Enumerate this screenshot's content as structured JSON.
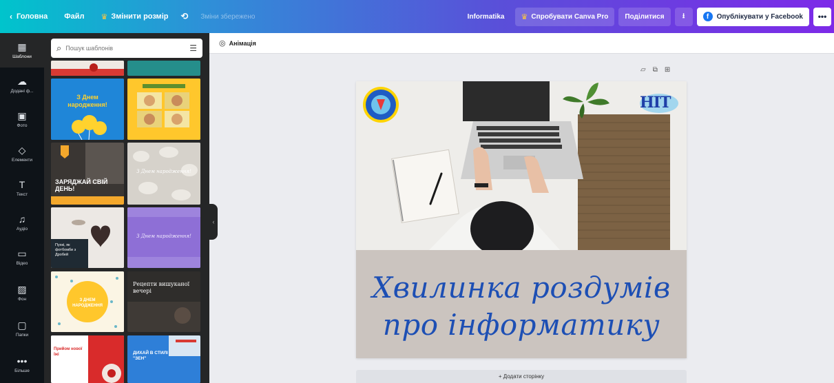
{
  "topbar": {
    "home": "Головна",
    "file": "Файл",
    "resize": "Змінити розмір",
    "saved_status": "Зміни збережено",
    "design_name": "Informatika",
    "try_pro": "Спробувати Canva Pro",
    "share": "Поділитися",
    "publish_facebook": "Опублікувати у Facebook",
    "more": "•••"
  },
  "rail": {
    "items": [
      {
        "label": "Шаблони",
        "icon": "layout-icon"
      },
      {
        "label": "Додані ф...",
        "icon": "cloud-upload-icon"
      },
      {
        "label": "Фото",
        "icon": "photo-icon"
      },
      {
        "label": "Елементи",
        "icon": "shapes-icon"
      },
      {
        "label": "Текст",
        "icon": "text-icon"
      },
      {
        "label": "Аудіо",
        "icon": "music-note-icon"
      },
      {
        "label": "Відео",
        "icon": "video-icon"
      },
      {
        "label": "Фон",
        "icon": "background-icon"
      },
      {
        "label": "Папки",
        "icon": "folder-icon"
      },
      {
        "label": "Більше",
        "icon": "more-dots-icon"
      }
    ]
  },
  "panel": {
    "search_placeholder": "Пошук шаблонів",
    "templates": [
      {
        "text": "З Днем народження!"
      },
      {
        "text": "ЗАРЯДЖАЙ СВІЙ ДЕНЬ!"
      },
      {
        "text": "З Днем народження!"
      },
      {
        "text": "Пухкі, як фотбомби з Дробей"
      },
      {
        "text": "З ДНЕМ НАРОДЖЕННЯ"
      },
      {
        "text": "Рецепти вишуканої вечері"
      },
      {
        "text": "Прийом нової їжі"
      },
      {
        "text": "ДИХАЙ В СТИЛІ \"ЗЕН\""
      }
    ]
  },
  "subbar": {
    "animation": "Анімація"
  },
  "canvas": {
    "caption_line1": "Хвилинка роздумів",
    "caption_line2": "про інформатику",
    "logo_right_text": "НІТ",
    "add_page": "+ Додати сторінку"
  },
  "colors": {
    "caption_bg": "#cbc4bf",
    "caption_text": "#1d4fb4",
    "pro_crown": "#ffc83d"
  }
}
